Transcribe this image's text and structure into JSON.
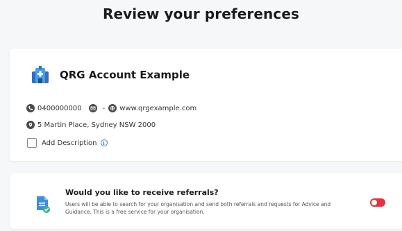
{
  "page": {
    "title": "Review your preferences"
  },
  "account": {
    "name": "QRG Account Example",
    "phone": "0400000000",
    "email_placeholder": "-",
    "website": "www.qrgexample.com",
    "address": "5 Martin Place, Sydney NSW 2000",
    "add_description_label": "Add Description",
    "add_description_checked": false,
    "icons": [
      "org-building-icon",
      "phone-icon",
      "email-icon",
      "globe-icon",
      "location-pin-icon",
      "info-icon"
    ]
  },
  "referrals": {
    "title": "Would you like to receive referrals?",
    "description": "Users will be able to search for your organisation and send both referrals and requests for Advice and Guidance. This is a free service for your organisation.",
    "toggle_on": false,
    "icons": [
      "document-check-icon"
    ]
  },
  "colors": {
    "accent_blue": "#3f8ee0",
    "toggle_red": "#e8313a",
    "check_green": "#3fb37f"
  }
}
